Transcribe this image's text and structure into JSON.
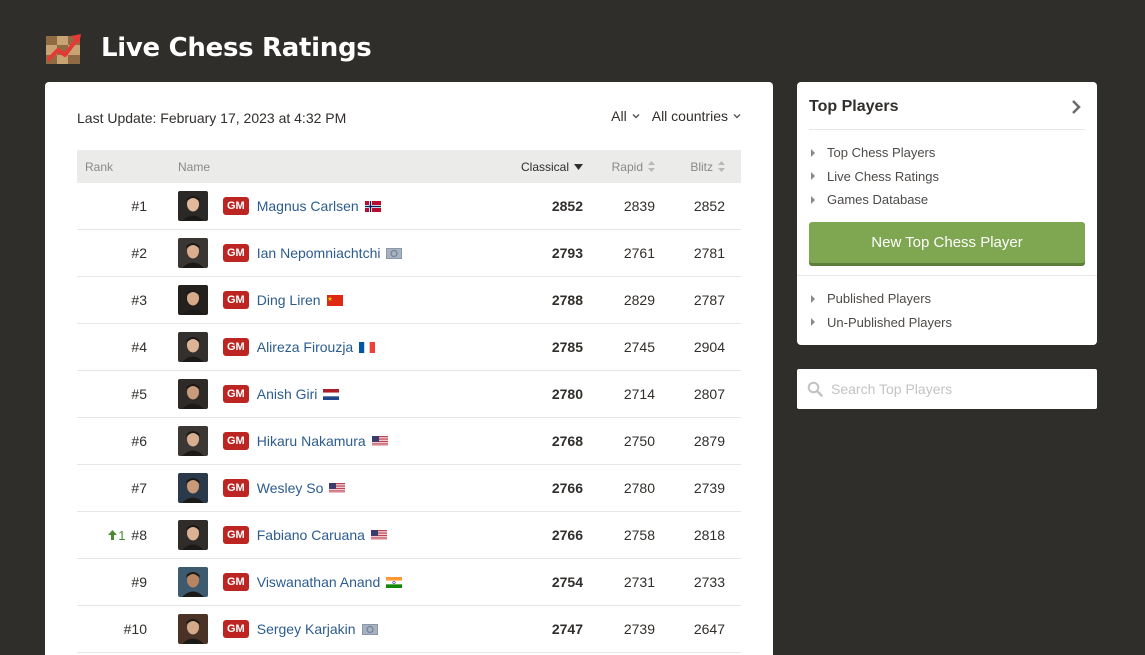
{
  "header": {
    "title": "Live Chess Ratings",
    "icon": "chart-trend-icon"
  },
  "main": {
    "last_update": "Last Update: February 17, 2023 at 4:32 PM",
    "filters": [
      {
        "label": "All"
      },
      {
        "label": "All countries"
      }
    ],
    "columns": {
      "rank": "Rank",
      "name": "Name",
      "classical": "Classical",
      "rapid": "Rapid",
      "blitz": "Blitz"
    },
    "players": [
      {
        "rank": "#1",
        "change": "",
        "title": "GM",
        "name": "Magnus Carlsen",
        "flag": "norway",
        "classical": "2852",
        "rapid": "2839",
        "blitz": "2852"
      },
      {
        "rank": "#2",
        "change": "",
        "title": "GM",
        "name": "Ian Nepomniachtchi",
        "flag": "fide",
        "classical": "2793",
        "rapid": "2761",
        "blitz": "2781"
      },
      {
        "rank": "#3",
        "change": "",
        "title": "GM",
        "name": "Ding Liren",
        "flag": "china",
        "classical": "2788",
        "rapid": "2829",
        "blitz": "2787"
      },
      {
        "rank": "#4",
        "change": "",
        "title": "GM",
        "name": "Alireza Firouzja",
        "flag": "france",
        "classical": "2785",
        "rapid": "2745",
        "blitz": "2904"
      },
      {
        "rank": "#5",
        "change": "",
        "title": "GM",
        "name": "Anish Giri",
        "flag": "netherlands",
        "classical": "2780",
        "rapid": "2714",
        "blitz": "2807"
      },
      {
        "rank": "#6",
        "change": "",
        "title": "GM",
        "name": "Hikaru Nakamura",
        "flag": "usa",
        "classical": "2768",
        "rapid": "2750",
        "blitz": "2879"
      },
      {
        "rank": "#7",
        "change": "",
        "title": "GM",
        "name": "Wesley So",
        "flag": "usa",
        "classical": "2766",
        "rapid": "2780",
        "blitz": "2739"
      },
      {
        "rank": "#8",
        "change": "1",
        "title": "GM",
        "name": "Fabiano Caruana",
        "flag": "usa",
        "classical": "2766",
        "rapid": "2758",
        "blitz": "2818"
      },
      {
        "rank": "#9",
        "change": "",
        "title": "GM",
        "name": "Viswanathan Anand",
        "flag": "india",
        "classical": "2754",
        "rapid": "2731",
        "blitz": "2733"
      },
      {
        "rank": "#10",
        "change": "",
        "title": "GM",
        "name": "Sergey Karjakin",
        "flag": "fide",
        "classical": "2747",
        "rapid": "2739",
        "blitz": "2647"
      }
    ]
  },
  "sidebar": {
    "title": "Top Players",
    "links_top": [
      "Top Chess Players",
      "Live Chess Ratings",
      "Games Database"
    ],
    "button_label": "New Top Chess Player",
    "links_bottom": [
      "Published Players",
      "Un-Published Players"
    ],
    "search_placeholder": "Search Top Players"
  },
  "colors": {
    "background": "#302e2b",
    "accent_green": "#7fa650",
    "gm_red": "#bd2522",
    "link_blue": "#2c5c8f"
  }
}
